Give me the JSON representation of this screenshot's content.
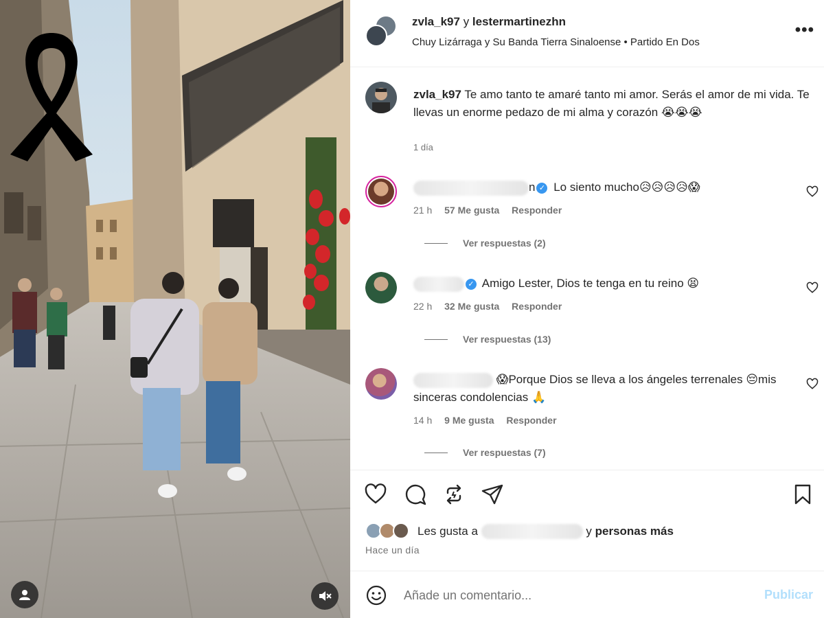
{
  "colors": {
    "accent": "#0095f6",
    "publish_disabled": "#b2dffc",
    "muted_text": "#737373",
    "verified": "#3897f0"
  },
  "media": {
    "icons": {
      "ribbon": "mourning-ribbon-icon",
      "user": "user-icon",
      "mute": "speaker-muted-icon"
    }
  },
  "header": {
    "user1": "zvla_k97",
    "joiner": "y",
    "user2": "lestermartinezhn",
    "song": "Chuy Lizárraga y Su Banda Tierra Sinaloense • Partido En Dos",
    "more_icon": "•••"
  },
  "caption": {
    "username": "zvla_k97",
    "text": "Te amo tanto te amaré tanto mi amor. Serás el amor de mi vida. Te llevas un enorme pedazo de mi alma y corazón 😭😭😭",
    "time": "1 día"
  },
  "comments": [
    {
      "username_suffix": "n",
      "text": "Lo siento mucho😥😥😥😥😱",
      "time": "21 h",
      "likes": "57 Me gusta",
      "reply": "Responder",
      "view_replies": "Ver respuestas (2)"
    },
    {
      "username_suffix": "",
      "text": "Amigo Lester, Dios te tenga en tu reino 😫",
      "time": "22 h",
      "likes": "32 Me gusta",
      "reply": "Responder",
      "view_replies": "Ver respuestas (13)"
    },
    {
      "username_suffix": "",
      "text": "😱Porque Dios se lleva a los ángeles terrenales 😔mis sinceras condolencias 🙏",
      "time": "14 h",
      "likes": "9 Me gusta",
      "reply": "Responder",
      "view_replies": "Ver respuestas (7)"
    }
  ],
  "actions": {
    "likes_prefix": "Les gusta a",
    "likes_joiner": "y",
    "likes_rest": "personas más",
    "time_ago": "Hace un día"
  },
  "add_comment": {
    "placeholder": "Añade un comentario...",
    "publish": "Publicar"
  }
}
